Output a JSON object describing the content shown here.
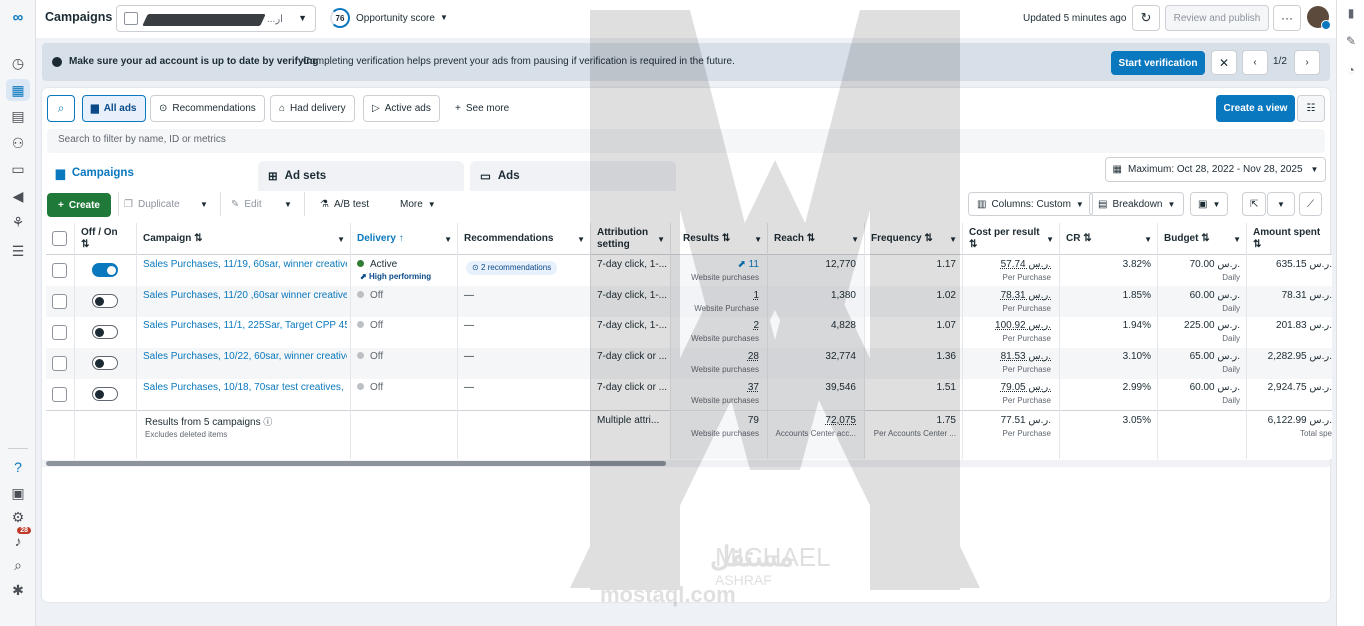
{
  "topbar": {
    "title": "Campaigns",
    "account_suffix": "...ار",
    "opportunity_score": "76",
    "opportunity_label": "Opportunity score",
    "updated": "Updated 5 minutes ago",
    "review_publish": "Review and publish"
  },
  "banner": {
    "bold": "Make sure your ad account is up to date by verifying",
    "text": "Completing verification helps prevent your ads from pausing if verification is required in the future.",
    "button": "Start verification",
    "pager": "1/2"
  },
  "filters": {
    "all_ads": "All ads",
    "recommendations": "Recommendations",
    "had_delivery": "Had delivery",
    "active_ads": "Active ads",
    "see_more": "See more",
    "create_view": "Create a view",
    "search_placeholder": "Search to filter by name, ID or metrics"
  },
  "tabs": {
    "campaigns": "Campaigns",
    "ad_sets": "Ad sets",
    "ads": "Ads",
    "date_range": "Maximum: Oct 28, 2022 - Nov 28, 2025"
  },
  "toolbar": {
    "create": "Create",
    "duplicate": "Duplicate",
    "edit": "Edit",
    "ab_test": "A/B test",
    "more": "More",
    "columns": "Columns: Custom",
    "breakdown": "Breakdown"
  },
  "headers": {
    "offon": "Off / On",
    "campaign": "Campaign",
    "delivery": "Delivery",
    "recommendations": "Recommendations",
    "attribution": "Attribution setting",
    "results": "Results",
    "reach": "Reach",
    "frequency": "Frequency",
    "cpr": "Cost per result",
    "cr": "CR",
    "budget": "Budget",
    "amount": "Amount spent"
  },
  "rows": [
    {
      "name": "Sales Purchases, 11/19, 60sar, winner creative",
      "on": true,
      "delivery": "Active",
      "delivery_sub": "High performing",
      "recs": "2 recommendations",
      "attr": "7-day click, 1-...",
      "results": "11",
      "results_sub": "Website purchases",
      "reach": "12,770",
      "freq": "1.17",
      "cpr": "57.74 ر.س.",
      "cpr_sub": "Per Purchase",
      "cr": "3.82%",
      "budget": "70.00 ر.س.",
      "budget_sub": "Daily",
      "amount": "635.15 ر.س."
    },
    {
      "name": "Sales Purchases, 11/20 ,60sar winner creative...",
      "on": false,
      "delivery": "Off",
      "delivery_sub": "",
      "recs": "—",
      "attr": "7-day click, 1-...",
      "results": "1",
      "results_sub": "Website Purchase",
      "reach": "1,380",
      "freq": "1.02",
      "cpr": "78.31 ر.س.",
      "cpr_sub": "Per Purchase",
      "cr": "1.85%",
      "budget": "60.00 ر.س.",
      "budget_sub": "Daily",
      "amount": "78.31 ر.س."
    },
    {
      "name": "Sales Purchases, 11/1, 225Sar, Target CPP 45...",
      "on": false,
      "delivery": "Off",
      "delivery_sub": "",
      "recs": "—",
      "attr": "7-day click, 1-...",
      "results": "2",
      "results_sub": "Website purchases",
      "reach": "4,828",
      "freq": "1.07",
      "cpr": "100.92 ر.س.",
      "cpr_sub": "Per Purchase",
      "cr": "1.94%",
      "budget": "225.00 ر.س.",
      "budget_sub": "Daily",
      "amount": "201.83 ر.س."
    },
    {
      "name": "Sales Purchases, 10/22, 60sar, winner creative",
      "on": false,
      "delivery": "Off",
      "delivery_sub": "",
      "recs": "—",
      "attr": "7-day click or ...",
      "results": "28",
      "results_sub": "Website purchases",
      "reach": "32,774",
      "freq": "1.36",
      "cpr": "81.53 ر.س.",
      "cpr_sub": "Per Purchase",
      "cr": "3.10%",
      "budget": "65.00 ر.س.",
      "budget_sub": "Daily",
      "amount": "2,282.95 ر.س."
    },
    {
      "name": "Sales Purchases, 10/18, 70sar test creatives, ...",
      "on": false,
      "delivery": "Off",
      "delivery_sub": "",
      "recs": "—",
      "attr": "7-day click or ...",
      "results": "37",
      "results_sub": "Website purchases",
      "reach": "39,546",
      "freq": "1.51",
      "cpr": "79.05 ر.س.",
      "cpr_sub": "Per Purchase",
      "cr": "2.99%",
      "budget": "60.00 ر.س.",
      "budget_sub": "Daily",
      "amount": "2,924.75 ر.س."
    }
  ],
  "totals": {
    "label": "Results from 5 campaigns",
    "sub": "Excludes deleted items",
    "attr": "Multiple attri...",
    "results": "79",
    "results_sub": "Website purchases",
    "reach": "72,075",
    "reach_sub": "Accounts Center acc...",
    "freq": "1.75",
    "freq_sub": "Per Accounts Center ...",
    "cpr": "77.51 ر.س.",
    "cpr_sub": "Per Purchase",
    "cr": "3.05%",
    "amount": "6,122.99 ر.س.",
    "amount_sub": "Total spe"
  },
  "watermark": {
    "name1": "MICHAEL",
    "name2": "ASHRAF",
    "site": "mostaql.com",
    "arabic": "مستقل"
  },
  "notifications": "28",
  "colors": {
    "accent": "#0a78be",
    "active_green": "#2e7d32"
  }
}
